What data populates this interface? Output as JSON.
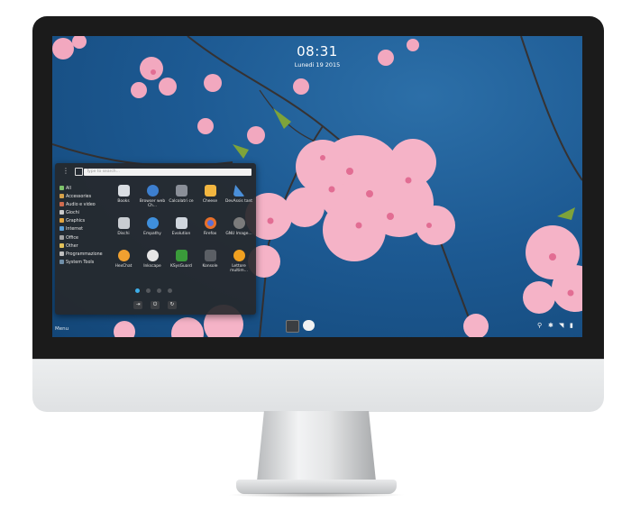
{
  "clock": {
    "time": "08:31",
    "date": "Lunedi 19 2015"
  },
  "search": {
    "placeholder": "Type to search..."
  },
  "categories": [
    {
      "label": "All",
      "color": "#7ec36b"
    },
    {
      "label": "Accessories",
      "color": "#d6a14a"
    },
    {
      "label": "Audio e video",
      "color": "#cf6b4f"
    },
    {
      "label": "Giochi",
      "color": "#c9c9c9"
    },
    {
      "label": "Graphics",
      "color": "#e0a440"
    },
    {
      "label": "Internet",
      "color": "#5a9fd8"
    },
    {
      "label": "Office",
      "color": "#a3a3a3"
    },
    {
      "label": "Other",
      "color": "#e3c25b"
    },
    {
      "label": "Programmazione",
      "color": "#bfbfbf"
    },
    {
      "label": "System Tools",
      "color": "#6f8ea8"
    }
  ],
  "apps": [
    {
      "label": "Books",
      "color": "#d9dde2",
      "icon": "books-icon"
    },
    {
      "label": "Browser web Ch...",
      "color": "#3d7fcf",
      "icon": "browser-icon"
    },
    {
      "label": "Calcolatri ce",
      "color": "#8a8f98",
      "icon": "calculator-icon"
    },
    {
      "label": "Cheese",
      "color": "#f2b640",
      "icon": "cheese-icon"
    },
    {
      "label": "DevAssis tant",
      "color": "#4a8fd9",
      "icon": "devassistant-icon"
    },
    {
      "label": "Dischi",
      "color": "#c9cdd2",
      "icon": "disks-icon"
    },
    {
      "label": "Empathy",
      "color": "#3f8fdc",
      "icon": "empathy-icon"
    },
    {
      "label": "Evolution",
      "color": "#d0d6de",
      "icon": "evolution-icon"
    },
    {
      "label": "Firefox",
      "color": "#e8702a",
      "icon": "firefox-icon"
    },
    {
      "label": "GNU Image...",
      "color": "#7b7b7b",
      "icon": "gimp-icon"
    },
    {
      "label": "HexChat",
      "color": "#f0a030",
      "icon": "hexchat-icon"
    },
    {
      "label": "Inkscape",
      "color": "#e6e6e6",
      "icon": "inkscape-icon"
    },
    {
      "label": "KSysGuard",
      "color": "#3a9b3a",
      "icon": "ksysguard-icon"
    },
    {
      "label": "Konsole",
      "color": "#5b5f65",
      "icon": "konsole-icon"
    },
    {
      "label": "Lettore multim...",
      "color": "#f0a020",
      "icon": "media-player-icon"
    }
  ],
  "power": [
    {
      "glyph": "⇥",
      "icon": "logout-icon"
    },
    {
      "glyph": "⏻",
      "icon": "power-icon"
    },
    {
      "glyph": "↻",
      "icon": "restart-icon"
    }
  ],
  "panel": {
    "menu_label": "Menu"
  },
  "tray": [
    {
      "glyph": "⚲",
      "icon": "location-icon"
    },
    {
      "glyph": "✱",
      "icon": "bluetooth-icon"
    },
    {
      "glyph": "◥",
      "icon": "network-icon"
    },
    {
      "glyph": "▮",
      "icon": "battery-icon"
    }
  ],
  "colors": {
    "accent": "#3daee9",
    "sky": "#1d5a93",
    "blossom": "#f2a8bf"
  }
}
